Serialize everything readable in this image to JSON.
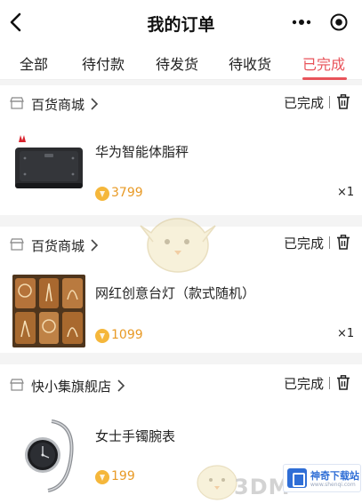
{
  "header": {
    "title": "我的订单"
  },
  "tabs": [
    {
      "label": "全部",
      "active": false
    },
    {
      "label": "待付款",
      "active": false
    },
    {
      "label": "待发货",
      "active": false
    },
    {
      "label": "待收货",
      "active": false
    },
    {
      "label": "已完成",
      "active": true
    }
  ],
  "orders": [
    {
      "shop": "百货商城",
      "status": "已完成",
      "product": "华为智能体脂秤",
      "price": "3799",
      "qty": "×1",
      "image": "smart-scale-image"
    },
    {
      "shop": "百货商城",
      "status": "已完成",
      "product": "网红创意台灯（款式随机）",
      "price": "1099",
      "qty": "×1",
      "image": "desk-lamp-image"
    },
    {
      "shop": "快小集旗舰店",
      "status": "已完成",
      "product": "女士手镯腕表",
      "price": "199",
      "qty": "",
      "image": "bracelet-watch-image"
    }
  ],
  "watermark": {
    "text": "3DM",
    "badge": "神奇下载站",
    "badge_sub": "www.shenqi.com"
  },
  "colors": {
    "accent": "#e8535a",
    "price": "#e89a26",
    "background": "#f4f4f4"
  }
}
